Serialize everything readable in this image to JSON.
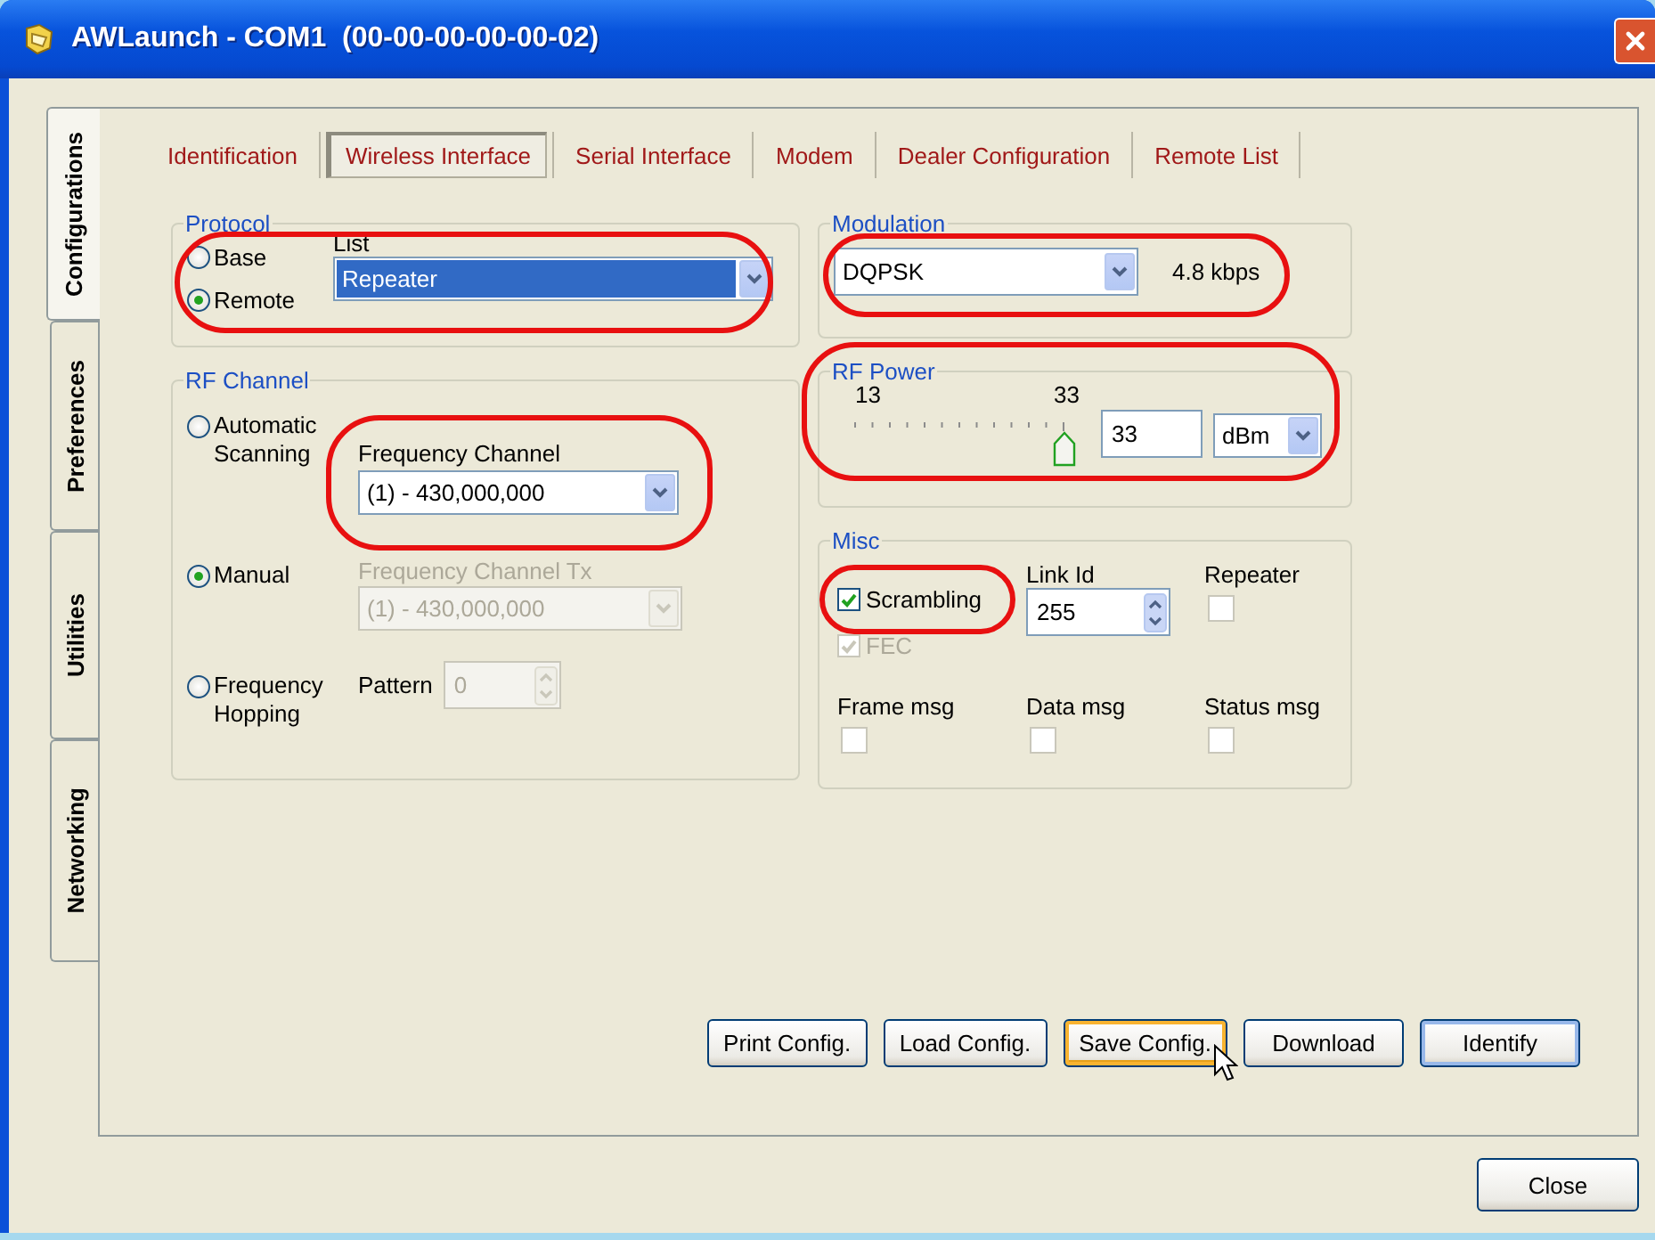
{
  "window": {
    "title": "AWLaunch - COM1  (00-00-00-00-00-02)"
  },
  "side_tabs": [
    {
      "label": "Configurations",
      "selected": true
    },
    {
      "label": "Preferences",
      "selected": false
    },
    {
      "label": "Utilities",
      "selected": false
    },
    {
      "label": "Networking",
      "selected": false
    }
  ],
  "tabs": [
    {
      "label": "Identification",
      "selected": false
    },
    {
      "label": "Wireless Interface",
      "selected": true
    },
    {
      "label": "Serial Interface",
      "selected": false
    },
    {
      "label": "Modem",
      "selected": false
    },
    {
      "label": "Dealer Configuration",
      "selected": false
    },
    {
      "label": "Remote List",
      "selected": false
    }
  ],
  "protocol": {
    "title": "Protocol",
    "highlighted": true,
    "options": [
      {
        "label": "Base",
        "selected": false
      },
      {
        "label": "Remote",
        "selected": true
      }
    ],
    "list_label": "List",
    "list_value": "Repeater"
  },
  "rf_channel": {
    "title": "RF Channel",
    "options": [
      {
        "label": "Automatic Scanning",
        "selected": false
      },
      {
        "label": "Manual",
        "selected": true
      },
      {
        "label": "Frequency Hopping",
        "selected": false
      }
    ],
    "frequency_channel": {
      "label": "Frequency Channel",
      "value": "(1) - 430,000,000",
      "disabled": false,
      "highlighted": true
    },
    "frequency_channel_tx": {
      "label": "Frequency Channel Tx",
      "value": "(1) - 430,000,000",
      "disabled": true
    },
    "pattern": {
      "label": "Pattern",
      "value": "0",
      "disabled": true
    }
  },
  "modulation": {
    "title": "Modulation",
    "value": "DQPSK",
    "rate": "4.8 kbps",
    "highlighted": true
  },
  "rf_power": {
    "title": "RF Power",
    "min": "13",
    "max": "33",
    "level": 1.0,
    "value": "33",
    "unit": "dBm",
    "highlighted": true
  },
  "misc": {
    "title": "Misc",
    "checks": [
      {
        "label": "Scrambling",
        "checked": true,
        "disabled": false,
        "highlighted": true
      },
      {
        "label": "FEC",
        "checked": true,
        "disabled": true,
        "highlighted": false
      }
    ],
    "link_id": {
      "label": "Link Id",
      "value": "255"
    },
    "repeater": {
      "label": "Repeater",
      "checked": false
    },
    "flags": [
      {
        "label": "Frame msg",
        "checked": false
      },
      {
        "label": "Data msg",
        "checked": false
      },
      {
        "label": "Status msg",
        "checked": false
      }
    ]
  },
  "buttons": [
    {
      "label": "Print Config.",
      "hovered": false,
      "default": false
    },
    {
      "label": "Load Config.",
      "hovered": false,
      "default": false
    },
    {
      "label": "Save Config.",
      "hovered": true,
      "default": false
    },
    {
      "label": "Download",
      "hovered": false,
      "default": false
    },
    {
      "label": "Identify",
      "hovered": false,
      "default": true
    }
  ],
  "close_button": {
    "label": "Close"
  }
}
